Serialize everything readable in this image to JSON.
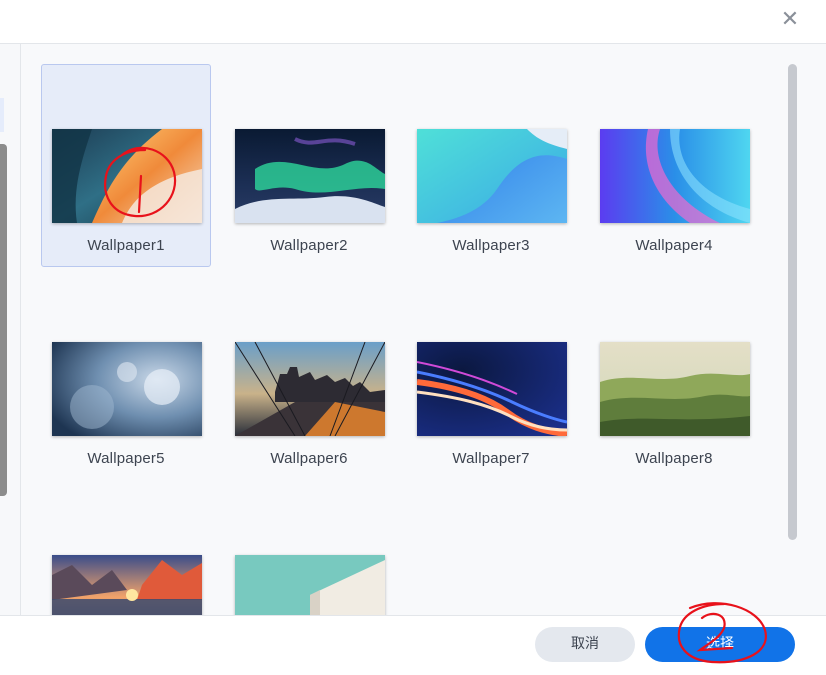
{
  "dialog": {
    "close_glyph": "✕",
    "cancel_label": "取消",
    "select_label": "选择"
  },
  "wallpapers": [
    {
      "label": "Wallpaper1",
      "selected": true
    },
    {
      "label": "Wallpaper2"
    },
    {
      "label": "Wallpaper3"
    },
    {
      "label": "Wallpaper4"
    },
    {
      "label": "Wallpaper5"
    },
    {
      "label": "Wallpaper6"
    },
    {
      "label": "Wallpaper7"
    },
    {
      "label": "Wallpaper8"
    },
    {
      "label": ""
    },
    {
      "label": ""
    }
  ],
  "colors": {
    "primary": "#1173e8",
    "selected_bg": "#e6ecf9",
    "annotation": "#e8121b"
  },
  "annotations": [
    "red circled number 1 on Wallpaper1",
    "red circled number 2 on select button"
  ]
}
